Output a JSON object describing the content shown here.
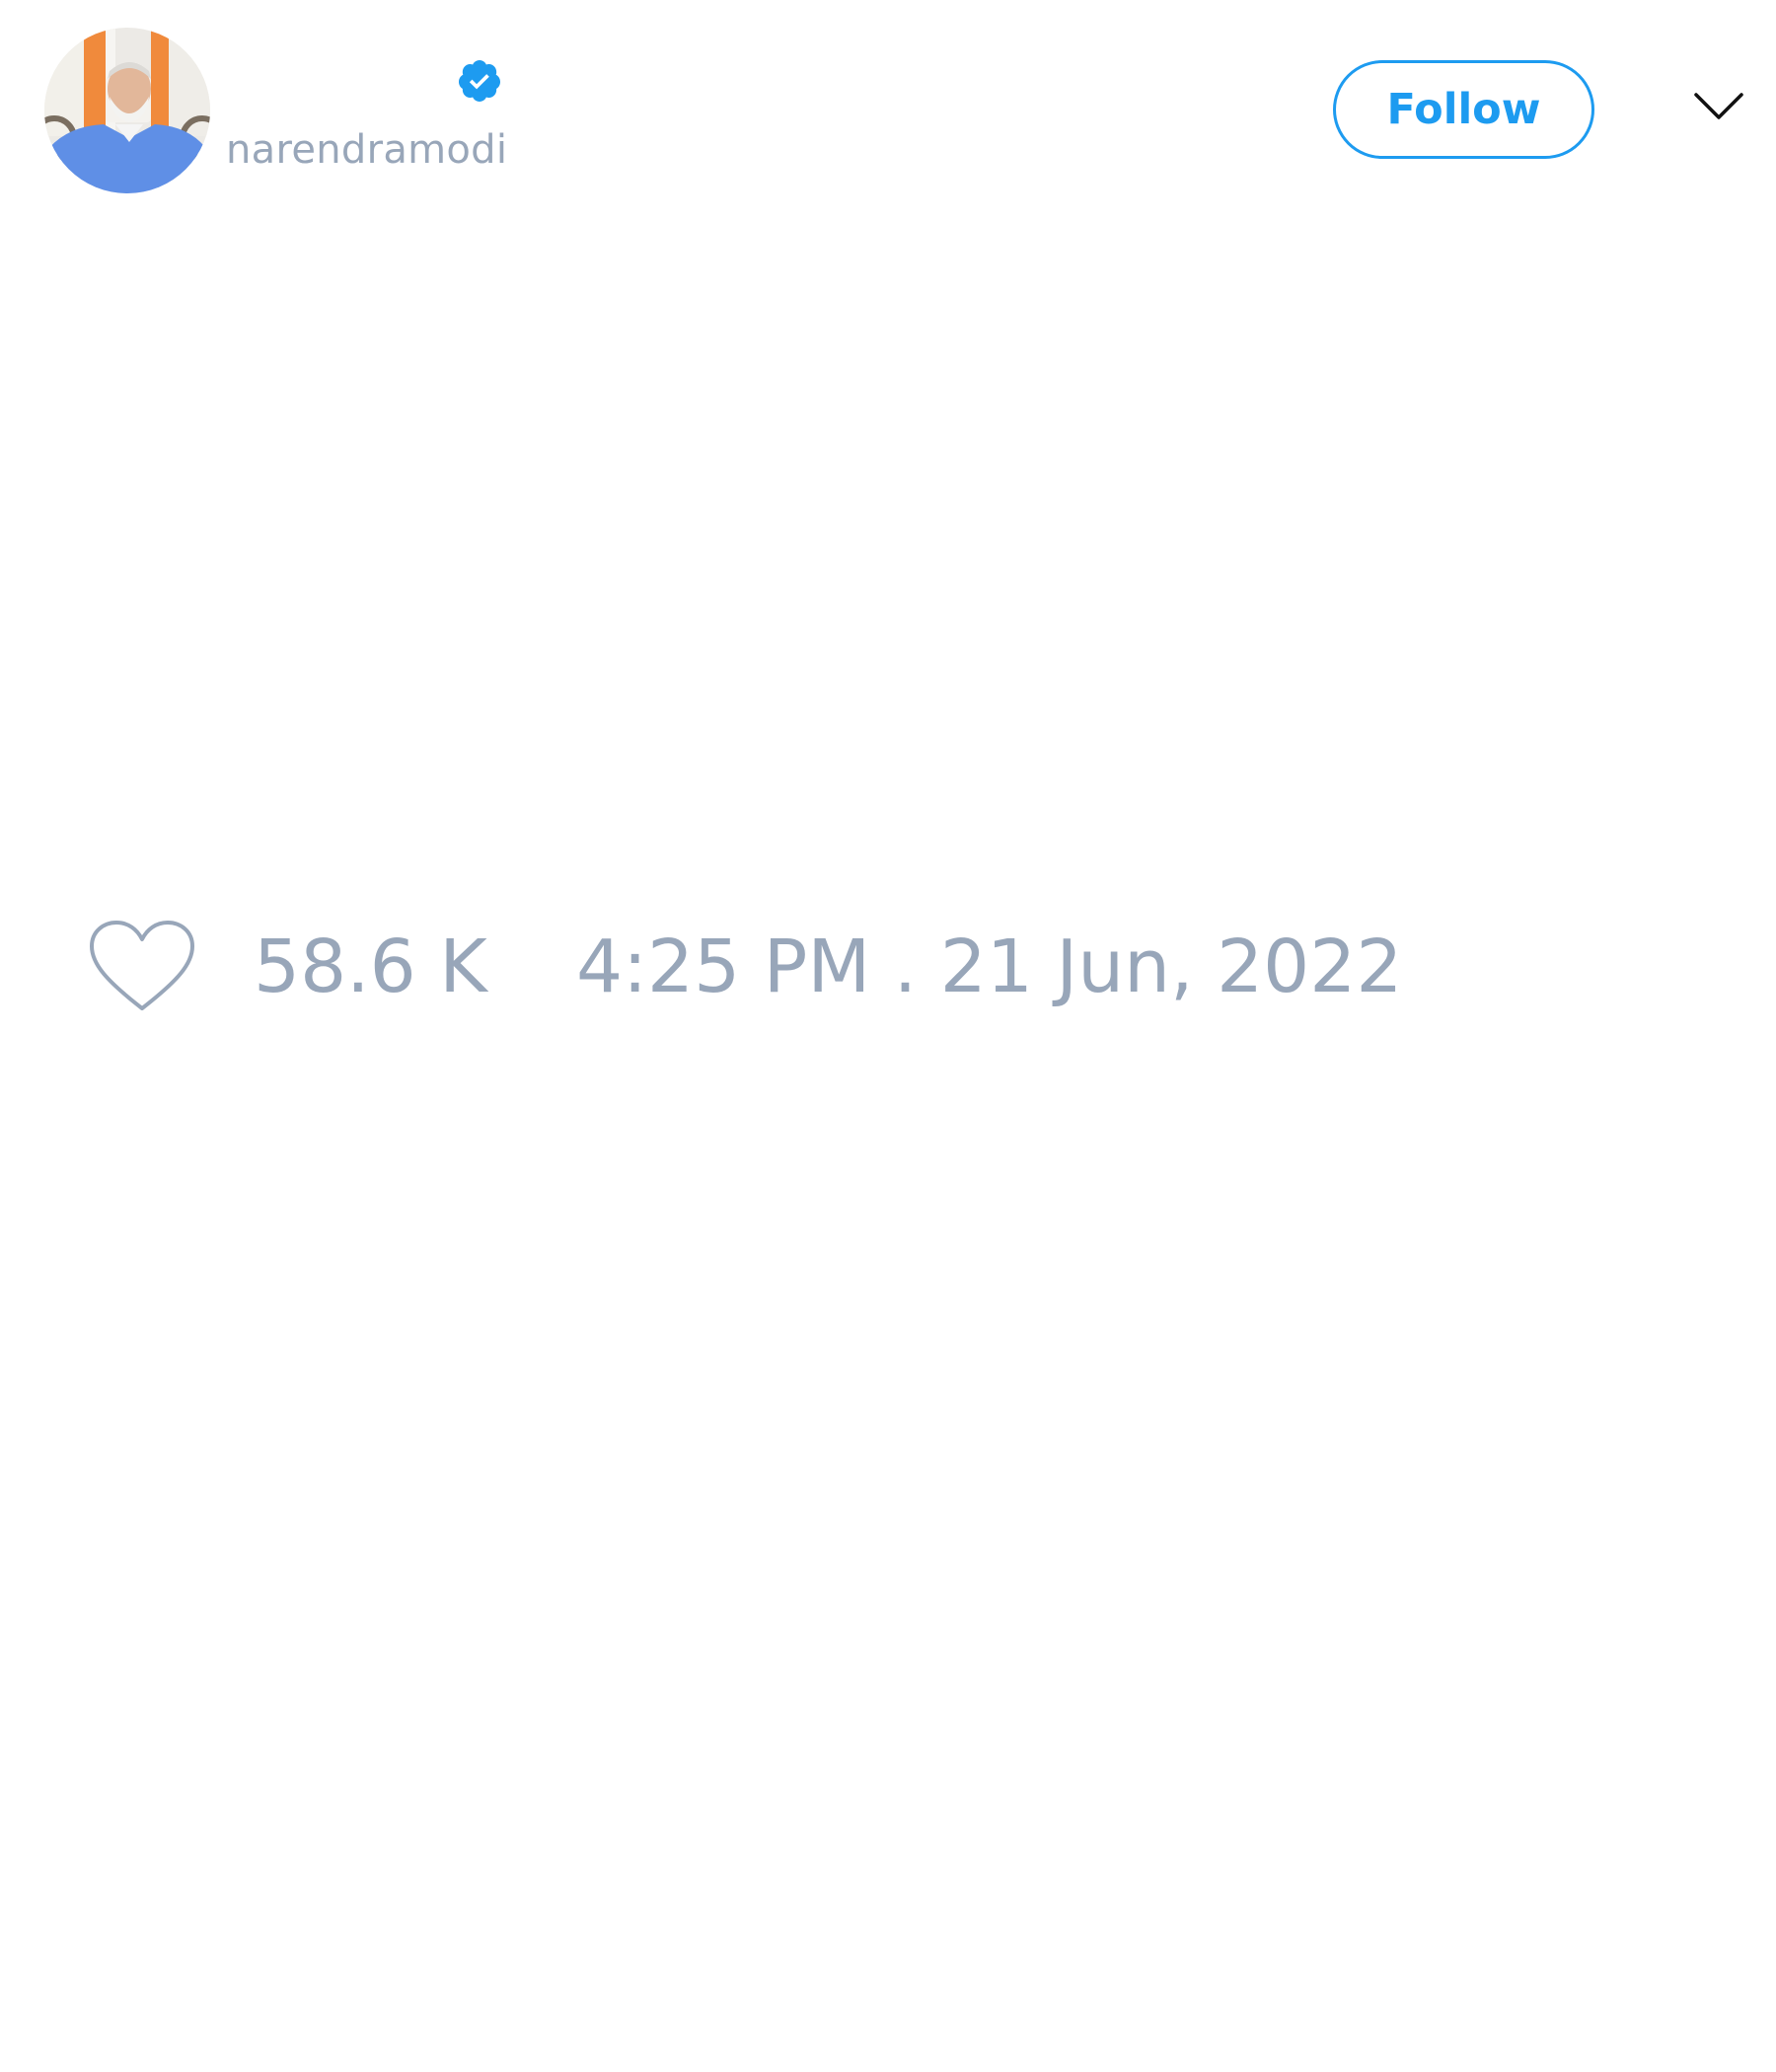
{
  "author": {
    "handle": "narendramodi",
    "verified": true
  },
  "header": {
    "follow_label": "Follow",
    "menu_icon": "chevron-down-icon"
  },
  "tweet": {
    "like_count": "58.6 K",
    "timestamp": "4:25 PM . 21 Jun, 2022"
  },
  "colors": {
    "accent": "#1d9bf0",
    "muted_text": "#98a6b9",
    "background": "#ffffff"
  }
}
